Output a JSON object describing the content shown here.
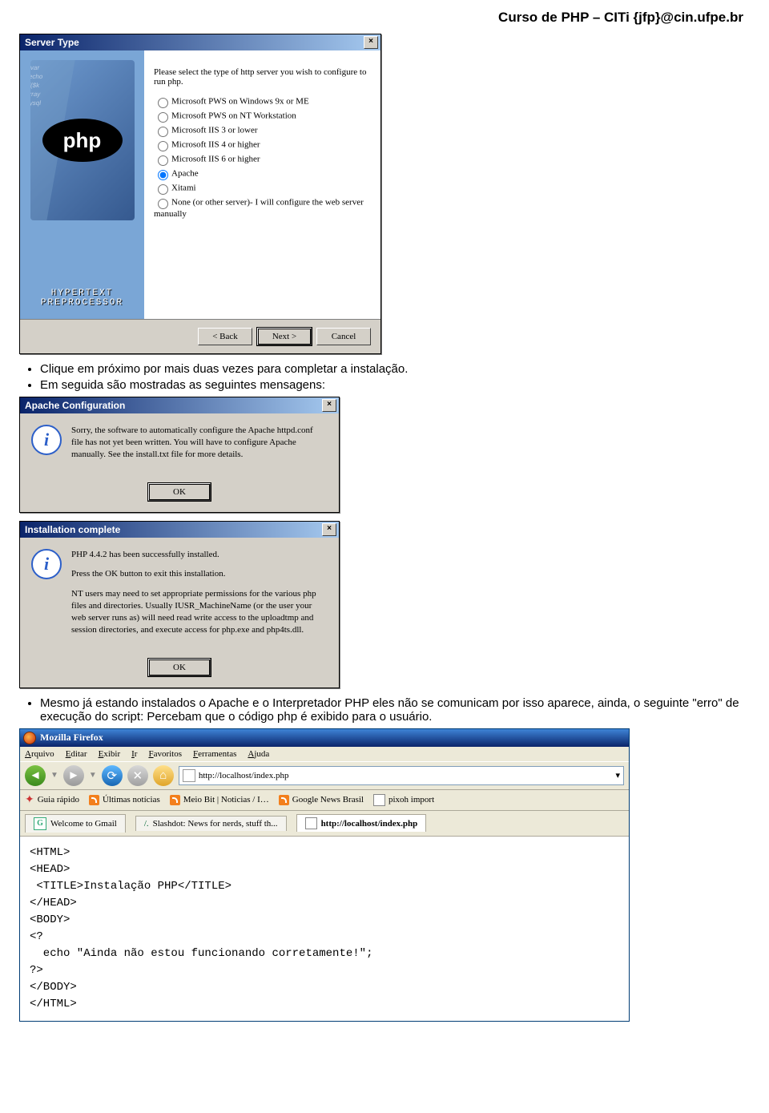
{
  "header": "Curso de PHP – CITi {jfp}@cin.ufpe.br",
  "bullet1": "Clique em próximo por mais duas vezes para completar a instalação.",
  "bullet2": "Em seguida são mostradas as seguintes mensagens:",
  "bullet3": "Mesmo já estando instalados o Apache e o Interpretador PHP eles não se comunicam por isso aparece, ainda, o seguinte \"erro\" de execução do script: Percebam que o código php é exibido para o usuário.",
  "wizard": {
    "title": "Server Type",
    "intro": "Please select the type of http server you wish to configure to run php.",
    "logo": "php",
    "side1": "HYPERTEXT",
    "side2": "PREPROCESSOR",
    "options": [
      "Microsoft PWS on Windows 9x or ME",
      "Microsoft PWS on NT Workstation",
      "Microsoft IIS 3 or lower",
      "Microsoft IIS 4 or higher",
      "Microsoft IIS 6 or higher",
      "Apache",
      "Xitami",
      "None (or other server)- I will configure the web server manually"
    ],
    "selected_index": 5,
    "back": "< Back",
    "next": "Next >",
    "cancel": "Cancel"
  },
  "msg1": {
    "title": "Apache Configuration",
    "text": "Sorry, the software to automatically configure the Apache httpd.conf file has not yet been written. You will have to configure Apache manually. See the install.txt file for more details.",
    "ok": "OK"
  },
  "msg2": {
    "title": "Installation complete",
    "p1": "PHP 4.4.2 has been successfully installed.",
    "p2": "Press the OK button to exit this installation.",
    "p3": "NT users may need to set appropriate permissions for the various php files and directories. Usually IUSR_MachineName (or the user your web server runs as) will need read write access to the uploadtmp and session directories, and execute access for php.exe and php4ts.dll.",
    "ok": "OK"
  },
  "firefox": {
    "app_title": "Mozilla Firefox",
    "menu": [
      "Arquivo",
      "Editar",
      "Exibir",
      "Ir",
      "Favoritos",
      "Ferramentas",
      "Ajuda"
    ],
    "address": "http://localhost/index.php",
    "bookmarks": {
      "guia": "Guia rápido",
      "ultimas": "Últimas notícias",
      "meio": "Meio Bit | Noticias / I…",
      "google": "Google News Brasil",
      "pixoh": "pixoh import"
    },
    "tabs": {
      "gmail": "Welcome to Gmail",
      "slashdot": "Slashdot: News for nerds, stuff th...",
      "local": "http://localhost/index.php"
    },
    "code_lines": [
      "<HTML>",
      "<HEAD>",
      " <TITLE>Instalação PHP</TITLE>",
      "</HEAD>",
      "<BODY>",
      "<?",
      "  echo \"Ainda não estou funcionando corretamente!\";",
      "?>",
      "</BODY>",
      "</HTML>"
    ]
  }
}
